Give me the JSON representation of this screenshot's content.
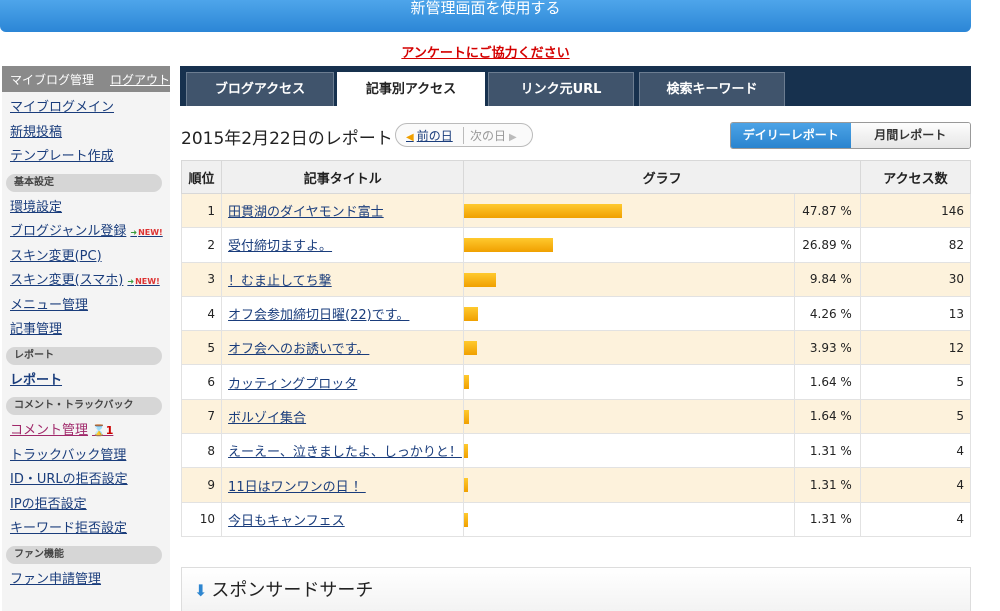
{
  "banner": {
    "label": "新管理画面を使用する"
  },
  "survey": {
    "label": "アンケートにご協力ください"
  },
  "sidebar": {
    "header": "マイブログ管理",
    "logout": "ログアウト",
    "main_links": [
      "マイブログメイン",
      "新規投稿",
      "テンプレート作成"
    ],
    "sec_basic": "基本設定",
    "basic_links": [
      {
        "label": "環境設定",
        "new": ""
      },
      {
        "label": "ブログジャンル登録",
        "new": "NEW!"
      },
      {
        "label": "スキン変更(PC)",
        "new": ""
      },
      {
        "label": "スキン変更(スマホ)",
        "new": "NEW!"
      },
      {
        "label": "メニュー管理",
        "new": ""
      },
      {
        "label": "記事管理",
        "new": ""
      }
    ],
    "sec_report": "レポート",
    "report_link": "レポート",
    "sec_comment": "コメント・トラックバック",
    "comment_link": "コメント管理",
    "comment_badge": "⌛1",
    "comment_links": [
      "トラックバック管理",
      "ID・URLの拒否設定",
      "IPの拒否設定",
      "キーワード拒否設定"
    ],
    "sec_fan": "ファン機能",
    "fan_link": "ファン申請管理"
  },
  "tabs": [
    "ブログアクセス",
    "記事別アクセス",
    "リンク元URL",
    "検索キーワード"
  ],
  "report": {
    "title": "2015年2月22日のレポート",
    "prev": "前の日",
    "next": "次の日",
    "daily": "デイリーレポート",
    "monthly": "月間レポート"
  },
  "table": {
    "headers": {
      "rank": "順位",
      "title": "記事タイトル",
      "graph": "グラフ",
      "count": "アクセス数"
    },
    "rows": [
      {
        "rank": "1",
        "title": "田貫湖のダイヤモンド富士",
        "pct": "47.87 %",
        "ratio": 0.4787,
        "count": "146"
      },
      {
        "rank": "2",
        "title": "受付締切ますよ。",
        "pct": "26.89 %",
        "ratio": 0.2689,
        "count": "82"
      },
      {
        "rank": "3",
        "title": "！むま止してち撃",
        "pct": "9.84 %",
        "ratio": 0.0984,
        "count": "30"
      },
      {
        "rank": "4",
        "title": "オフ会参加締切日曜(22)です。",
        "pct": "4.26 %",
        "ratio": 0.0426,
        "count": "13"
      },
      {
        "rank": "5",
        "title": "オフ会へのお誘いです。",
        "pct": "3.93 %",
        "ratio": 0.0393,
        "count": "12"
      },
      {
        "rank": "6",
        "title": "カッティングプロッタ",
        "pct": "1.64 %",
        "ratio": 0.0164,
        "count": "5"
      },
      {
        "rank": "7",
        "title": "ボルゾイ集合",
        "pct": "1.64 %",
        "ratio": 0.0164,
        "count": "5"
      },
      {
        "rank": "8",
        "title": "えーえー、泣きましたよ、しっかりと！",
        "pct": "1.31 %",
        "ratio": 0.0131,
        "count": "4"
      },
      {
        "rank": "9",
        "title": "11日はワンワンの日 ！",
        "pct": "1.31 %",
        "ratio": 0.0131,
        "count": "4"
      },
      {
        "rank": "10",
        "title": "今日もキャンフェス",
        "pct": "1.31 %",
        "ratio": 0.0131,
        "count": "4"
      }
    ]
  },
  "sponsor": {
    "label": "スポンサードサーチ"
  },
  "colors": {
    "accent": "#2b86d6",
    "bar": "#f0a000",
    "tabbar": "#17314e",
    "row_alt": "#fdf2dc"
  }
}
